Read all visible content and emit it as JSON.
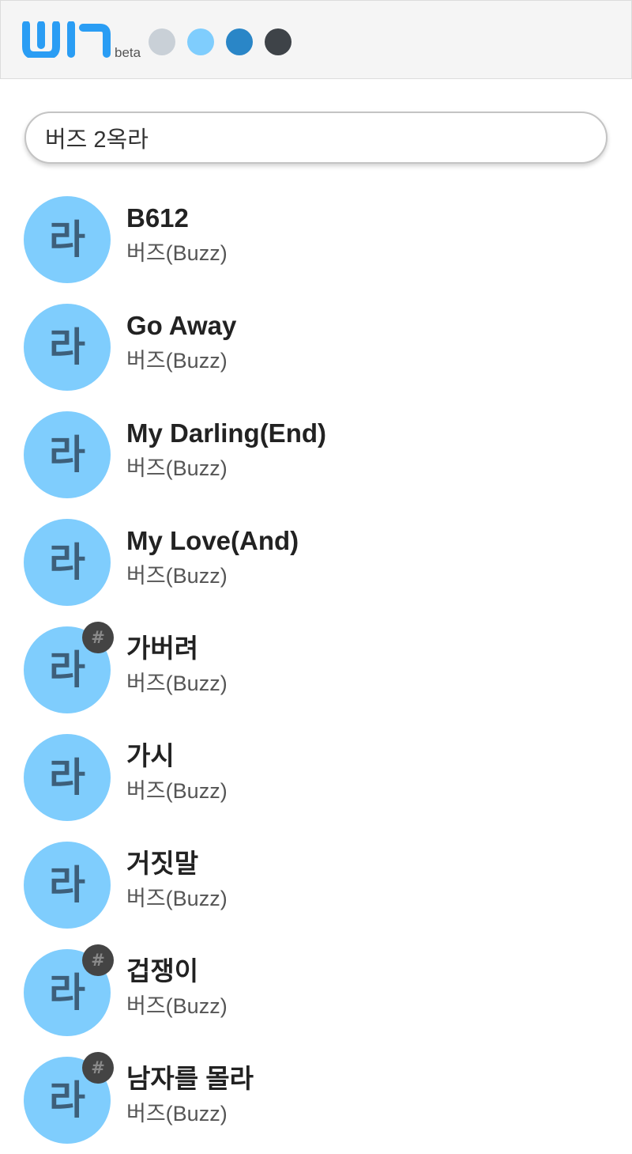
{
  "header": {
    "logo_text": "WIT",
    "beta_label": "beta",
    "logo_color": "#2a9df4",
    "theme_colors": [
      "#c9d0d7",
      "#7fcdfd",
      "#2a86c7",
      "#3e4348"
    ]
  },
  "search": {
    "value": "버즈 2옥라",
    "placeholder": ""
  },
  "results": [
    {
      "avatar": "라",
      "title": "B612",
      "artist": "버즈(Buzz)",
      "has_hash": false
    },
    {
      "avatar": "라",
      "title": "Go Away",
      "artist": "버즈(Buzz)",
      "has_hash": false
    },
    {
      "avatar": "라",
      "title": "My Darling(End)",
      "artist": "버즈(Buzz)",
      "has_hash": false
    },
    {
      "avatar": "라",
      "title": "My Love(And)",
      "artist": "버즈(Buzz)",
      "has_hash": false
    },
    {
      "avatar": "라",
      "title": "가버려",
      "artist": "버즈(Buzz)",
      "has_hash": true,
      "badge": "#"
    },
    {
      "avatar": "라",
      "title": "가시",
      "artist": "버즈(Buzz)",
      "has_hash": false
    },
    {
      "avatar": "라",
      "title": "거짓말",
      "artist": "버즈(Buzz)",
      "has_hash": false
    },
    {
      "avatar": "라",
      "title": "겁쟁이",
      "artist": "버즈(Buzz)",
      "has_hash": true,
      "badge": "#"
    },
    {
      "avatar": "라",
      "title": "남자를 몰라",
      "artist": "버즈(Buzz)",
      "has_hash": true,
      "badge": "#"
    }
  ]
}
